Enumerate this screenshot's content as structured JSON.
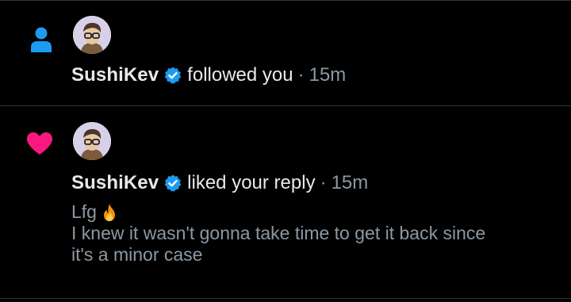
{
  "notifications": [
    {
      "type_icon": "person-icon",
      "icon_color": "#1d9bf0",
      "username": "SushiKev",
      "verified": true,
      "action": "followed you",
      "separator": "·",
      "time": "15m"
    },
    {
      "type_icon": "heart-icon",
      "icon_color": "#f91880",
      "username": "SushiKev",
      "verified": true,
      "action": "liked your reply",
      "separator": "·",
      "time": "15m",
      "reply_text_line1": "Lfg",
      "reply_emoji": "fire-emoji",
      "reply_text_line2": "I knew it wasn't gonna take time to get it back since",
      "reply_text_line3": "it's a minor case"
    }
  ],
  "colors": {
    "background": "#000000",
    "divider": "#2f3336",
    "verified_badge": "#1d9bf0",
    "secondary_text": "#8b98a5"
  }
}
